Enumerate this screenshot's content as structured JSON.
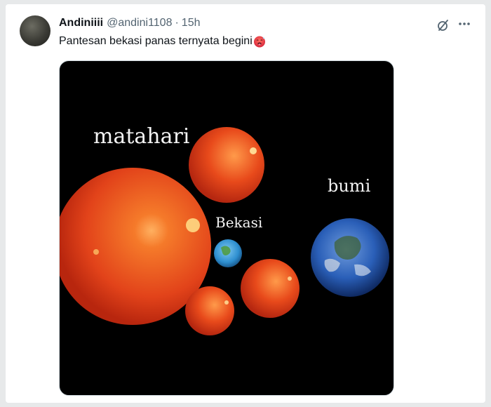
{
  "tweet": {
    "display_name": "Andiniiii",
    "handle": "@andini1108",
    "separator": "·",
    "time": "15h",
    "text": "Pantesan bekasi panas ternyata begini",
    "emoji": "hot-face-emoji"
  },
  "actions": {
    "grok_icon": "grok-icon",
    "more_icon": "more-icon"
  },
  "media": {
    "labels": {
      "matahari": "matahari",
      "bumi": "bumi",
      "bekasi": "Bekasi"
    }
  },
  "colors": {
    "name": "#0f1419",
    "secondary": "#536471",
    "background": "#e7e9ea",
    "card": "#ffffff",
    "sun": "#e8461a",
    "earth_ocean": "#2a5fb8"
  }
}
